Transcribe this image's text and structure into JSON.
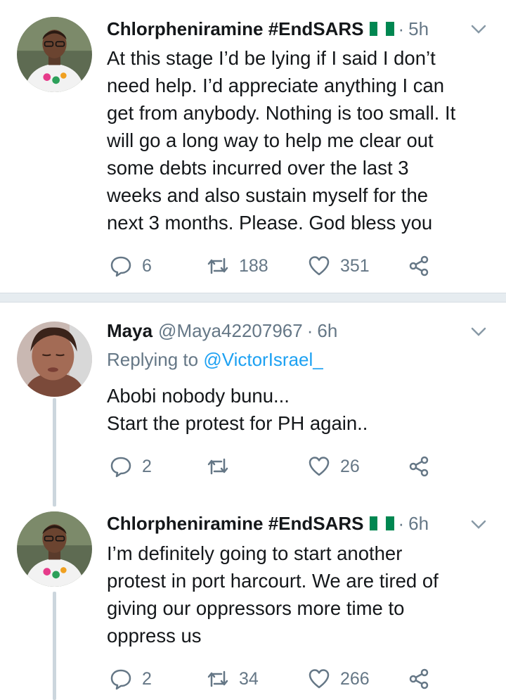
{
  "colors": {
    "text": "#14171a",
    "muted": "#657786",
    "link": "#1da1f2",
    "separator": "#e6ecf0",
    "thread_line": "#ccd6dd",
    "flag_green": "#008751",
    "flag_white": "#ffffff"
  },
  "tweets": [
    {
      "name": "Chlorpheniramine #EndSARS",
      "flag": "nigeria-flag",
      "time": "5h",
      "lines": [
        "At this stage I’d be lying if I said I don’t",
        "need help. I’d appreciate anything I can",
        "get from anybody. Nothing is too small. It",
        "will go a long way to help me clear out",
        "some debts incurred over the last 3",
        "weeks and also sustain myself for the",
        "next 3 months. Please. God bless you"
      ],
      "replies": "6",
      "retweets": "188",
      "likes": "351"
    },
    {
      "name": "Maya",
      "handle": "@Maya42207967",
      "time": "6h",
      "replying_label": "Replying to ",
      "replying_to": "@VictorIsrael_",
      "lines": [
        "Abobi nobody bunu...",
        "Start the protest for PH again.."
      ],
      "replies": "2",
      "retweets": "",
      "likes": "26"
    },
    {
      "name": "Chlorpheniramine #EndSARS",
      "flag": "nigeria-flag",
      "time": "6h",
      "lines": [
        "I’m definitely going to start another",
        "protest in port harcourt. We are tired of",
        "giving our oppressors more time to",
        "oppress us"
      ],
      "replies": "2",
      "retweets": "34",
      "likes": "266"
    }
  ]
}
